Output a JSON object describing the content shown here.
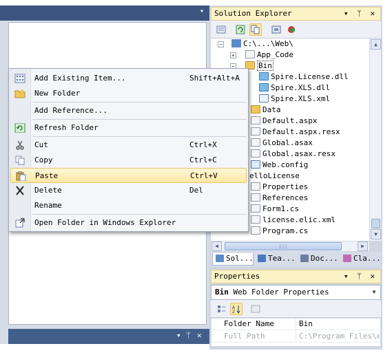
{
  "solution_explorer": {
    "title": "Solution Explorer",
    "tree": [
      {
        "label": "C:\\...\\Web\\"
      },
      {
        "label": "App_Code"
      },
      {
        "label": "Bin"
      },
      {
        "label": "Spire.License.dll"
      },
      {
        "label": "Spire.XLS.dll"
      },
      {
        "label": "Spire.XLS.xml"
      },
      {
        "label": "Data"
      },
      {
        "label": "Default.aspx"
      },
      {
        "label": "Default.aspx.resx"
      },
      {
        "label": "Global.asax"
      },
      {
        "label": "Global.asax.resx"
      },
      {
        "label": "Web.config"
      },
      {
        "label": "elloLicense"
      },
      {
        "label": "Properties"
      },
      {
        "label": "References"
      },
      {
        "label": "Form1.cs"
      },
      {
        "label": "license.elic.xml"
      },
      {
        "label": "Program.cs"
      }
    ],
    "tabs": [
      {
        "label": "Sol..."
      },
      {
        "label": "Tea..."
      },
      {
        "label": "Doc..."
      },
      {
        "label": "Cla..."
      }
    ]
  },
  "properties": {
    "title": "Properties",
    "selector_bold": "Bin",
    "selector_rest": " Web Folder Properties",
    "rows": [
      {
        "key": "Folder Name",
        "value": "Bin"
      },
      {
        "key": "Full Path",
        "value": "C:\\Program Files\\e-ic"
      }
    ]
  },
  "context_menu": {
    "items": [
      {
        "label": "Add Existing Item...",
        "shortcut": "Shift+Alt+A"
      },
      {
        "label": "New Folder",
        "shortcut": ""
      },
      {
        "label": "Add Reference...",
        "shortcut": ""
      },
      {
        "label": "Refresh Folder",
        "shortcut": ""
      },
      {
        "label": "Cut",
        "shortcut": "Ctrl+X"
      },
      {
        "label": "Copy",
        "shortcut": "Ctrl+C"
      },
      {
        "label": "Paste",
        "shortcut": "Ctrl+V"
      },
      {
        "label": "Delete",
        "shortcut": "Del"
      },
      {
        "label": "Rename",
        "shortcut": ""
      },
      {
        "label": "Open Folder in Windows Explorer",
        "shortcut": ""
      }
    ]
  },
  "panel_controls": {
    "dropdown": "▾",
    "pin": "ᛘ",
    "close": "✕"
  },
  "colors": {
    "title_bar_active": "#fbf2c6",
    "menu_highlight": "#fde8a4",
    "dock_background": "#cfd6e2"
  }
}
